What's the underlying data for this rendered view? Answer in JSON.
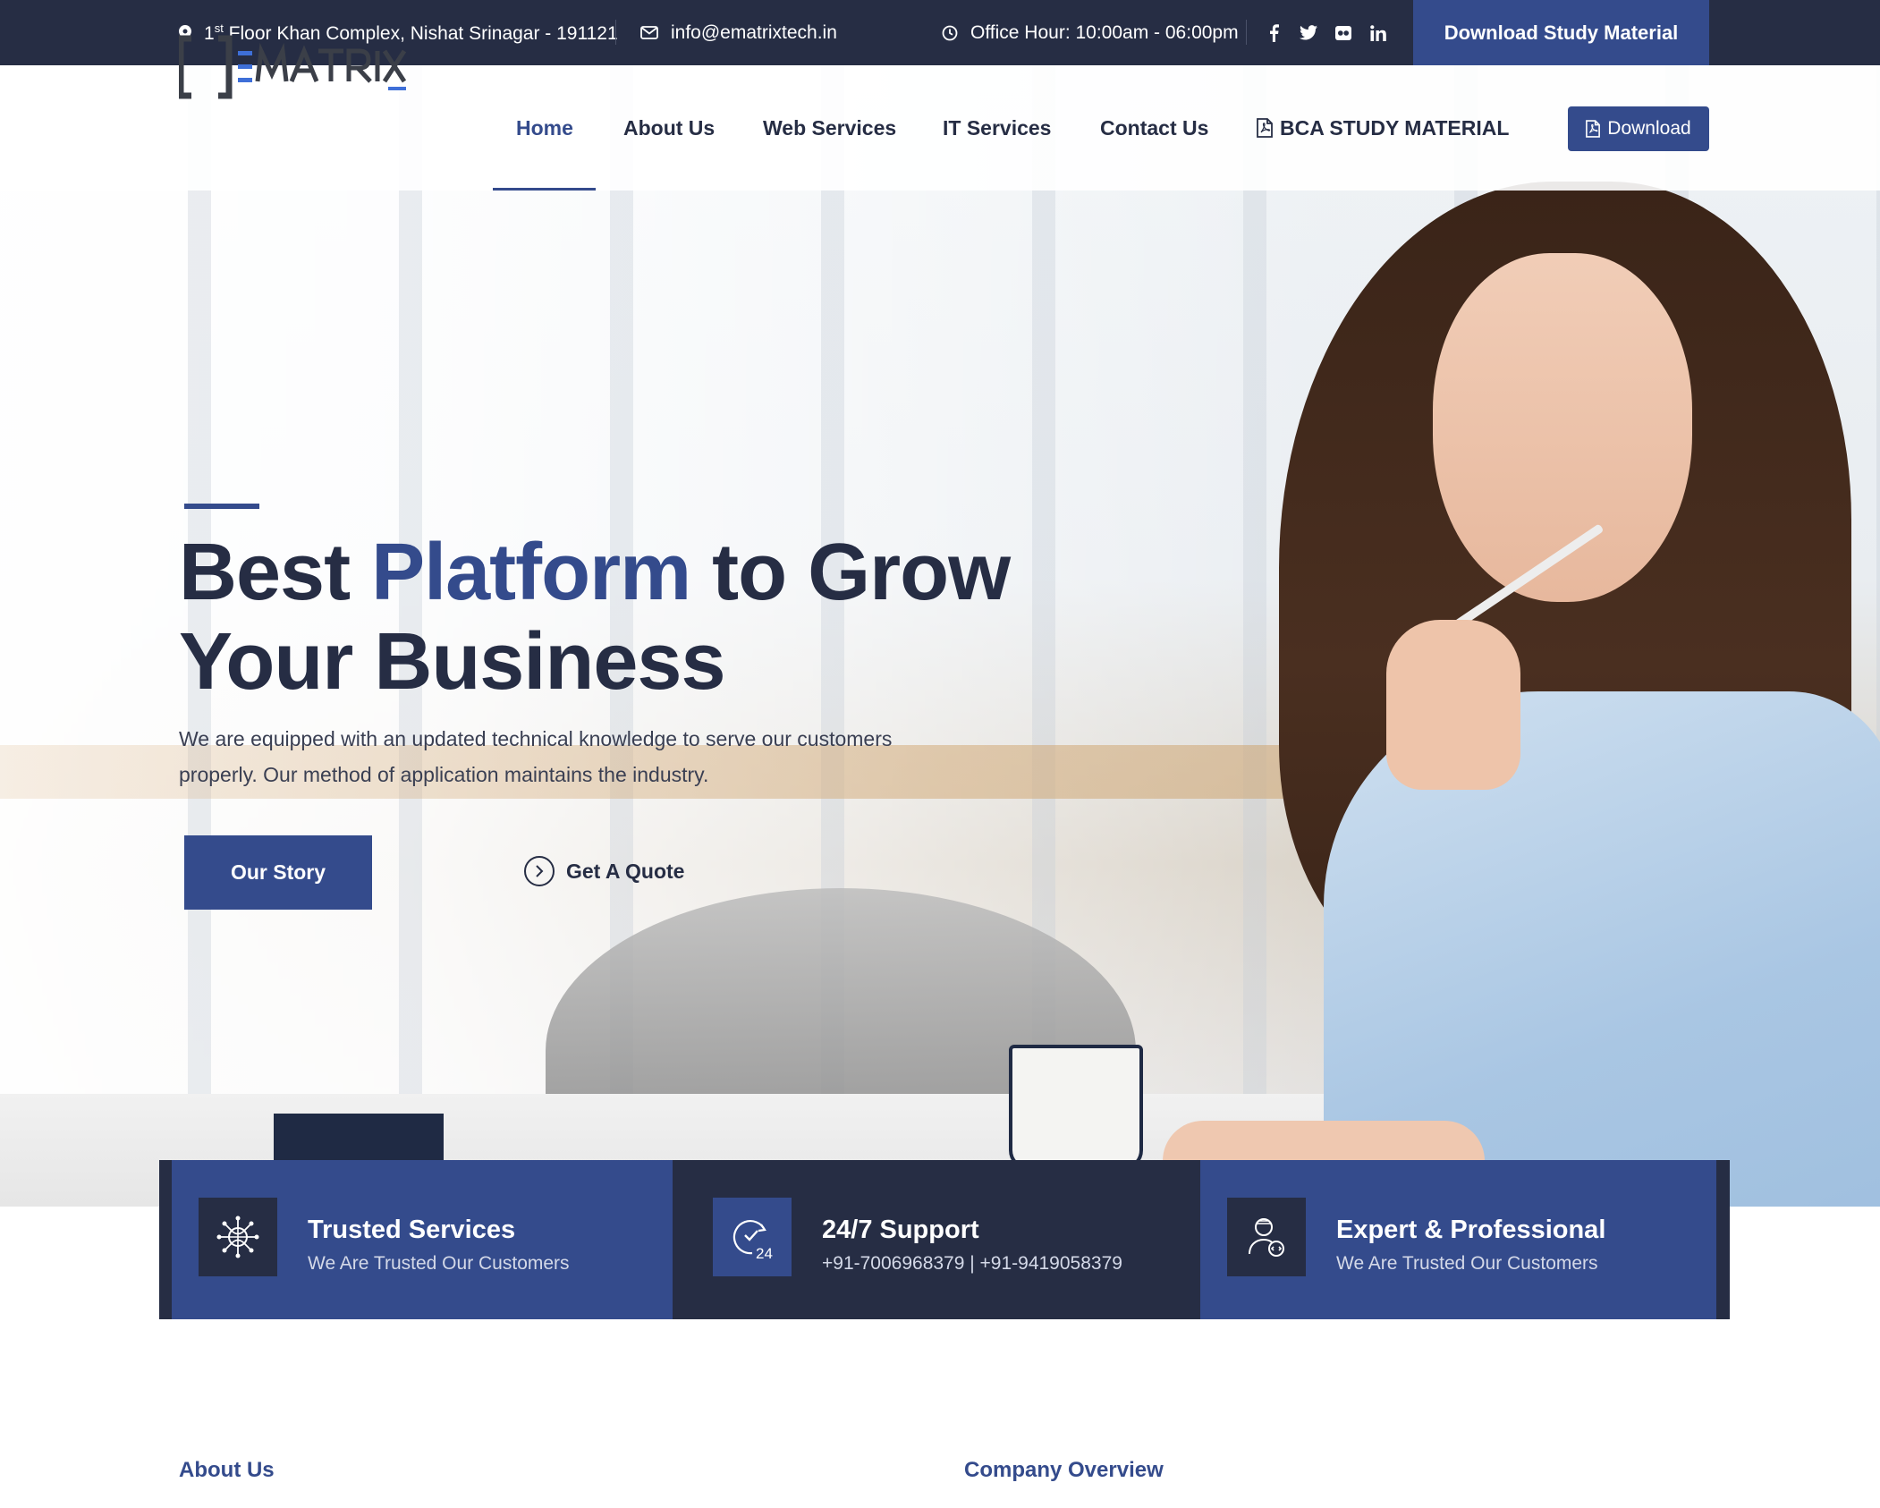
{
  "topbar": {
    "address_prefix": "1",
    "address_sup": "st",
    "address_rest": " Floor Khan Complex, Nishat Srinagar - 191121",
    "email": "info@ematrixtech.in",
    "office_hours": "Office Hour: 10:00am - 06:00pm",
    "social": [
      "facebook-icon",
      "twitter-icon",
      "flickr-icon",
      "linkedin-icon"
    ],
    "cta_label": "Download Study Material"
  },
  "header": {
    "logo_bracket": "[ ]",
    "logo_text": "EMATRIX",
    "nav": {
      "home": "Home",
      "about": "About Us",
      "web": "Web Services",
      "it": "IT Services",
      "contact": "Contact Us",
      "bca": "BCA STUDY MATERIAL"
    },
    "active_item": "Home",
    "download_label": "Download"
  },
  "hero": {
    "title_part1": "Best ",
    "title_highlight": "Platform",
    "title_part2": " to Grow",
    "title_line2": "Your Business",
    "subtitle": "We are equipped with an updated technical knowledge to serve our customers properly. Our method of application maintains the industry.",
    "btn_primary": "Our Story",
    "btn_secondary": "Get A Quote"
  },
  "features": [
    {
      "title": "Trusted Services",
      "subtitle": "We Are Trusted Our Customers",
      "icon": "network-globe-icon"
    },
    {
      "title": "24/7 Support",
      "subtitle": "+91-7006968379 | +91-9419058379",
      "icon": "support-24-icon"
    },
    {
      "title": "Expert & Professional",
      "subtitle": "We Are Trusted Our Customers",
      "icon": "expert-icon"
    }
  ],
  "bottom": {
    "left_heading": "About Us",
    "right_heading": "Company Overview"
  },
  "colors": {
    "navy": "#262d44",
    "accent": "#344b8c",
    "white": "#ffffff"
  }
}
